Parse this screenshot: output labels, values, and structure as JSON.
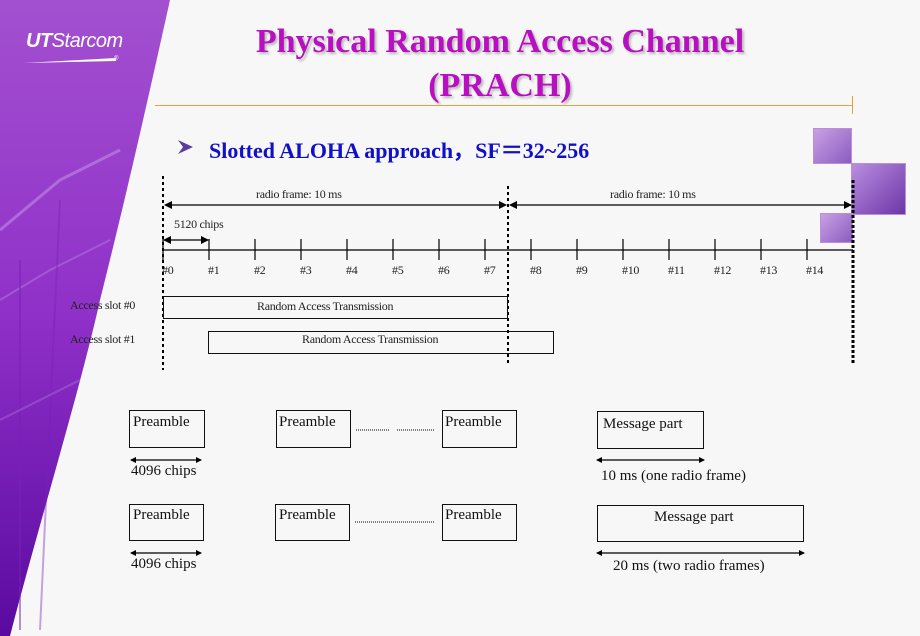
{
  "brand": {
    "logo_bold": "UT",
    "logo_rest": "Starcom",
    "registered_mark": "®",
    "accent_color": "#9d48d0"
  },
  "slide": {
    "title_line1": "Physical Random Access Channel",
    "title_line2": "(PRACH)",
    "title_color": "#b80fc0",
    "bullet_icon": "arrowhead-bullet-icon",
    "bullet_text": "Slotted ALOHA approach，SF＝32~256",
    "bullet_color": "#1010c8"
  },
  "timeline": {
    "frame_labels": [
      "radio frame: 10 ms",
      "radio frame: 10 ms"
    ],
    "slot_duration_label": "5120 chips",
    "slots": [
      "#0",
      "#1",
      "#2",
      "#3",
      "#4",
      "#5",
      "#6",
      "#7",
      "#8",
      "#9",
      "#10",
      "#11",
      "#12",
      "#13",
      "#14"
    ],
    "access_slots": [
      {
        "label": "Access slot #0",
        "transmission": "Random Access Transmission",
        "start_slot": 0,
        "length_slots": 7.5
      },
      {
        "label": "Access slot #1",
        "transmission": "Random Access Transmission",
        "start_slot": 1,
        "length_slots": 7.5
      }
    ]
  },
  "structures": [
    {
      "preambles": [
        "Preamble",
        "Preamble",
        "Preamble"
      ],
      "preamble_length_label": "4096 chips",
      "message": "Message part",
      "message_length_label": "10 ms (one radio frame)"
    },
    {
      "preambles": [
        "Preamble",
        "Preamble",
        "Preamble"
      ],
      "preamble_length_label": "4096 chips",
      "message": "Message part",
      "message_length_label": "20 ms (two radio frames)"
    }
  ],
  "decorations": [
    "people-photo-icon",
    "mobile-phone-photo-icon",
    "building-photo-icon"
  ]
}
